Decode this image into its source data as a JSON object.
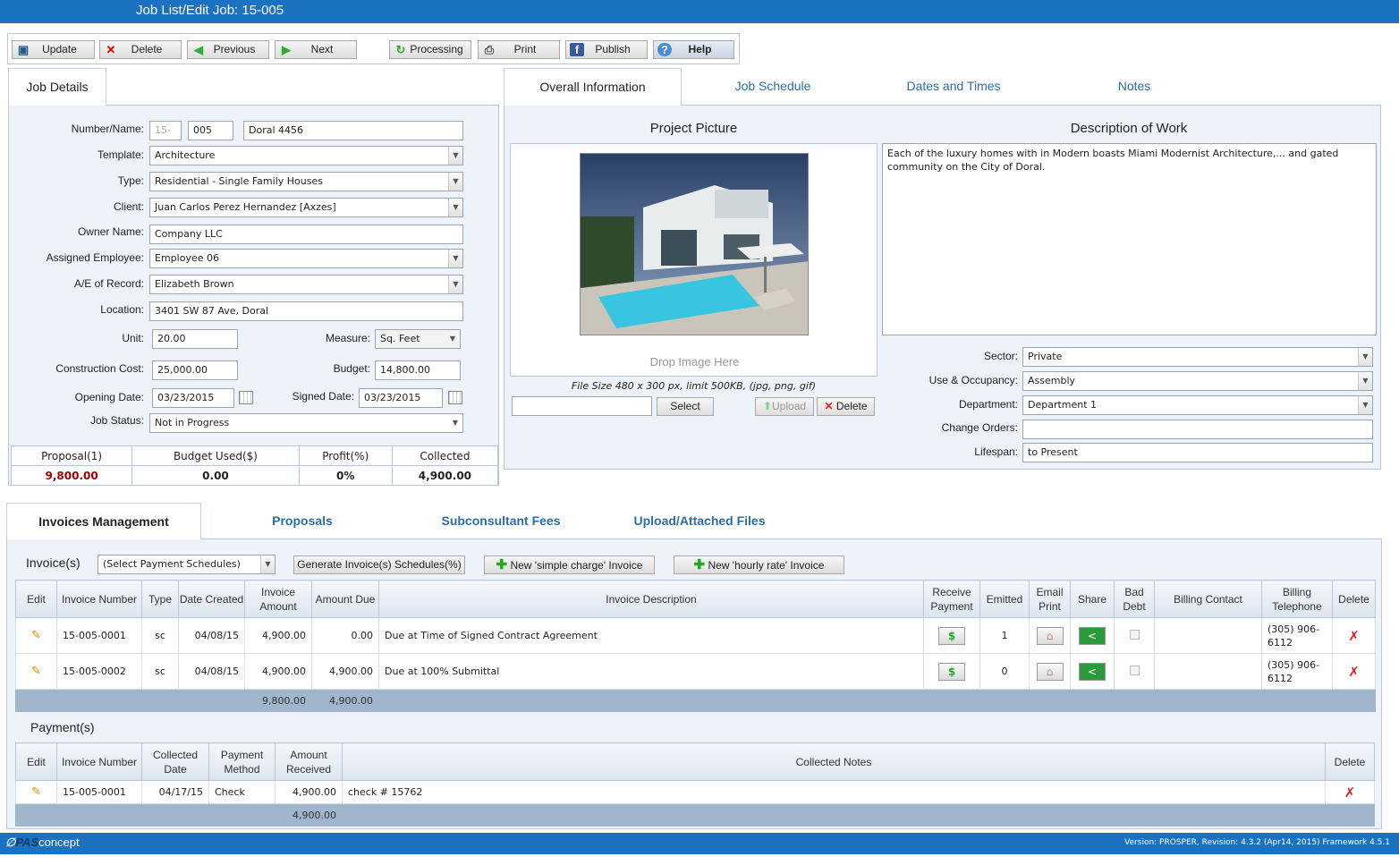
{
  "window": {
    "title": "Job List/Edit Job: 15-005"
  },
  "toolbar": {
    "update": "Update",
    "delete": "Delete",
    "previous": "Previous",
    "next": "Next",
    "processing": "Processing",
    "print": "Print",
    "publish": "Publish",
    "help": "Help"
  },
  "left_tab": "Job Details",
  "right_tabs": [
    "Overall Information",
    "Job Schedule",
    "Dates and Times",
    "Notes"
  ],
  "job": {
    "number_label": "Number/Name:",
    "number_prefix": "15-",
    "number": "005",
    "name": "Doral 4456",
    "template_label": "Template:",
    "template": "Architecture",
    "type_label": "Type:",
    "type": "Residential - Single Family Houses",
    "client_label": "Client:",
    "client": "Juan Carlos Perez Hernandez [Axzes]",
    "owner_label": "Owner Name:",
    "owner": "Company LLC",
    "employee_label": "Assigned Employee:",
    "employee": "Employee 06",
    "ae_label": "A/E of Record:",
    "ae": "Elizabeth Brown",
    "location_label": "Location:",
    "location": "3401 SW 87 Ave, Doral",
    "unit_label": "Unit:",
    "unit": "20.00",
    "measure_label": "Measure:",
    "measure": "Sq. Feet",
    "cost_label": "Construction Cost:",
    "cost": "25,000.00",
    "budget_label": "Budget:",
    "budget": "14,800.00",
    "opening_label": "Opening Date:",
    "opening": "03/23/2015",
    "signed_label": "Signed Date:",
    "signed": "03/23/2015",
    "status_label": "Job Status:",
    "status": "Not in Progress"
  },
  "summary": {
    "h_proposal": "Proposal(1)",
    "h_budget": "Budget Used($)",
    "h_profit": "Profit(%)",
    "h_collected": "Collected",
    "proposal": "9,800.00",
    "budget": "0.00",
    "profit": "0%",
    "collected": "4,900.00"
  },
  "overall": {
    "picture_title": "Project Picture",
    "drop_text": "Drop Image Here",
    "file_hint": "File Size 480 x 300 px, limit 500KB, (jpg, png, gif)",
    "select": "Select",
    "upload": "Upload",
    "delete": "Delete",
    "desc_title": "Description of Work",
    "description": "Each of the luxury homes with in Modern boasts Miami Modernist Architecture,... and gated community on the City of Doral.",
    "sector_label": "Sector:",
    "sector": "Private",
    "occupancy_label": "Use & Occupancy:",
    "occupancy": "Assembly",
    "department_label": "Department:",
    "department": "Department 1",
    "change_label": "Change Orders:",
    "change": "",
    "lifespan_label": "Lifespan:",
    "lifespan": "to Present"
  },
  "bottom_tabs": [
    "Invoices Management",
    "Proposals",
    "Subconsultant Fees",
    "Upload/Attached Files"
  ],
  "invoices": {
    "label": "Invoice(s)",
    "schedule_select": "(Select Payment Schedules)",
    "generate": "Generate Invoice(s) Schedules(%)",
    "new_simple": "New 'simple charge' Invoice",
    "new_hourly": "New 'hourly rate' Invoice",
    "headers": [
      "Edit",
      "Invoice Number",
      "Type",
      "Date Created",
      "Invoice Amount",
      "Amount Due",
      "Invoice Description",
      "Receive Payment",
      "Emitted",
      "Email Print",
      "Share",
      "Bad Debt",
      "Billing Contact",
      "Billing Telephone",
      "Delete"
    ],
    "rows": [
      {
        "number": "15-005-0001",
        "type": "sc",
        "date": "04/08/15",
        "amount": "4,900.00",
        "due": "0.00",
        "desc": "Due at Time of Signed Contract Agreement",
        "emitted": "1",
        "phone": "(305) 906-6112"
      },
      {
        "number": "15-005-0002",
        "type": "sc",
        "date": "04/08/15",
        "amount": "4,900.00",
        "due": "4,900.00",
        "desc": "Due at 100% Submittal",
        "emitted": "0",
        "phone": "(305) 906-6112"
      }
    ],
    "total_amount": "9,800.00",
    "total_due": "4,900.00"
  },
  "payments": {
    "label": "Payment(s)",
    "headers": [
      "Edit",
      "Invoice Number",
      "Collected Date",
      "Payment Method",
      "Amount Received",
      "Collected Notes",
      "Delete"
    ],
    "rows": [
      {
        "number": "15-005-0001",
        "date": "04/17/15",
        "method": "Check",
        "amount": "4,900.00",
        "notes": "check # 15762"
      }
    ],
    "total": "4,900.00"
  },
  "footer": {
    "brand": "concept",
    "version": "Version: PROSPER, Revision: 4.3.2 (Apr14, 2015) Framework 4.5.1"
  },
  "colors": {
    "titlebar": "#1a72c0",
    "panel": "#eef3f9",
    "link": "#2c6ea8",
    "proposal": "#a00000"
  }
}
